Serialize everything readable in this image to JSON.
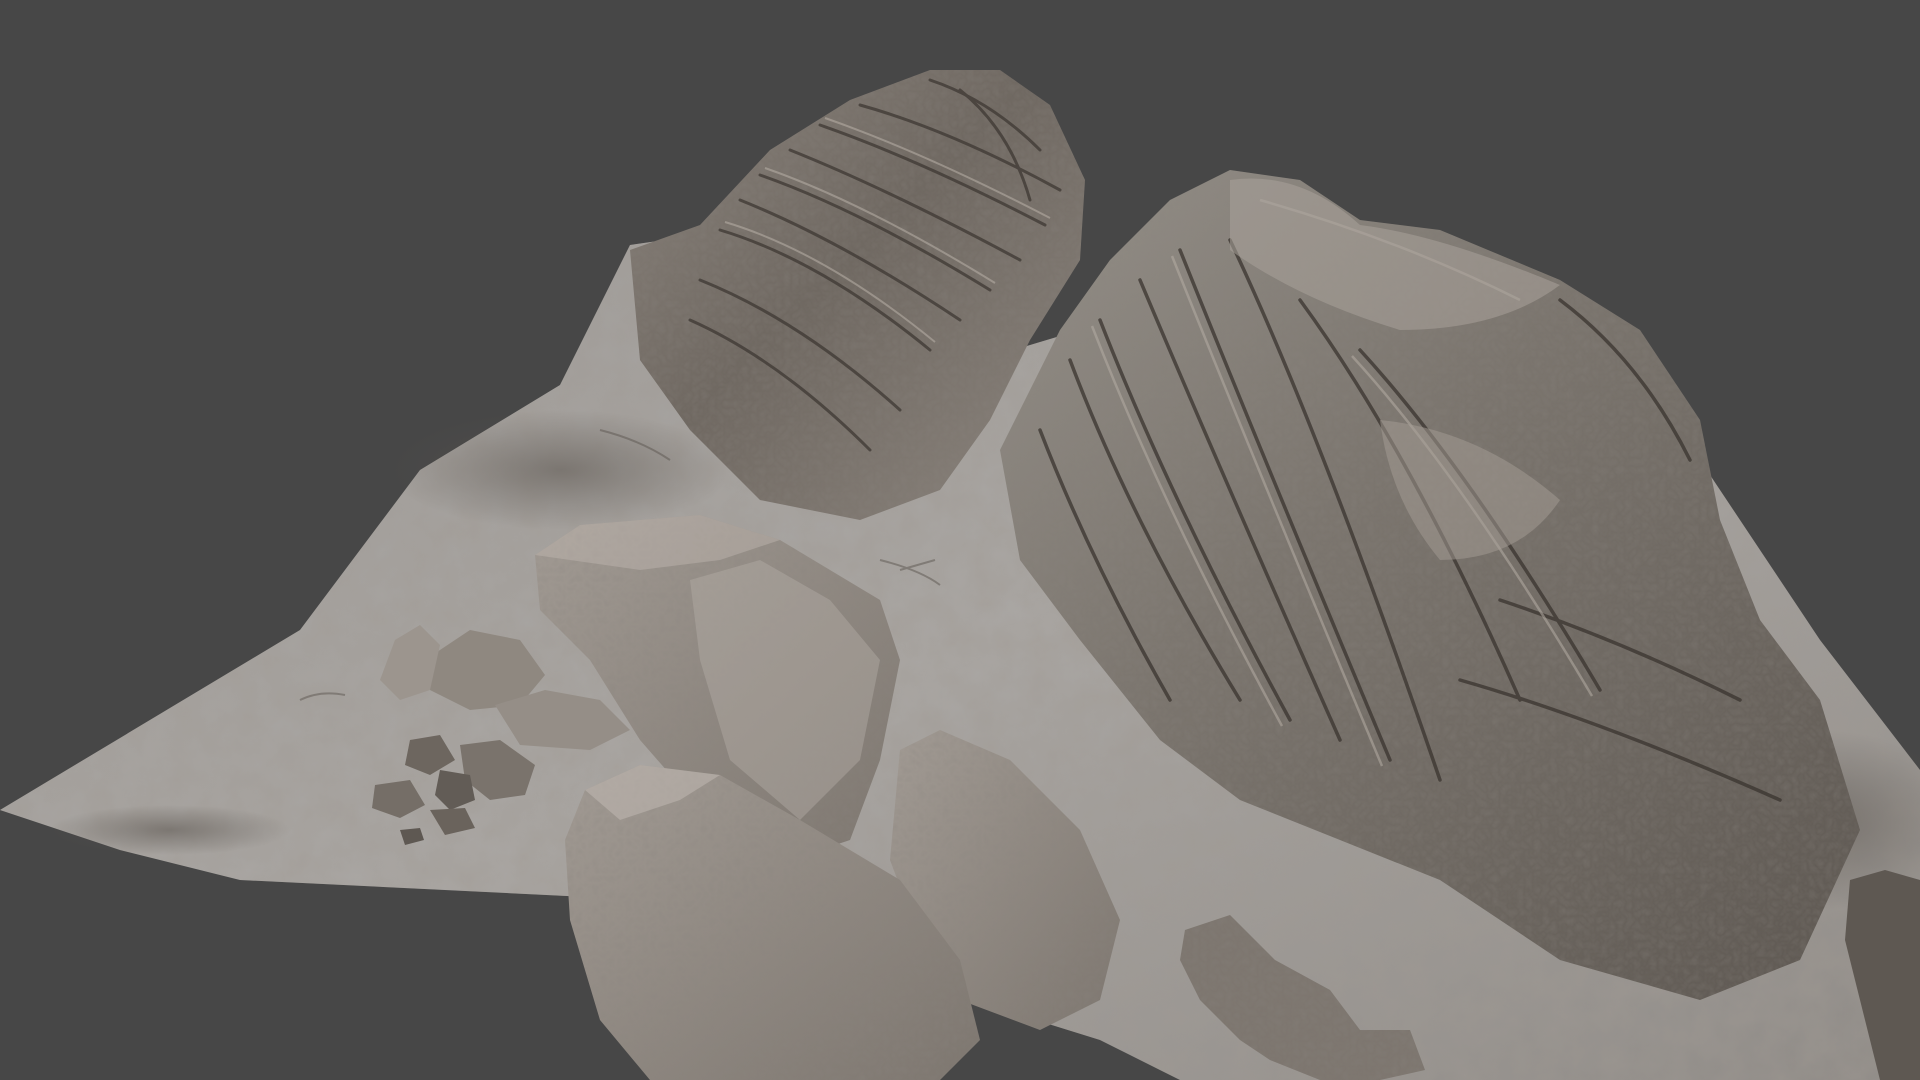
{
  "viewport": {
    "background_color": "#474747",
    "subject": "rock-formation-terrain-model",
    "colors": {
      "ground_light": "#a7a5a3",
      "ground_mid": "#8f8c89",
      "rock_light": "#9a938c",
      "rock_mid": "#7a736c",
      "rock_dark": "#4f4943",
      "crevice": "#3a3530"
    }
  }
}
